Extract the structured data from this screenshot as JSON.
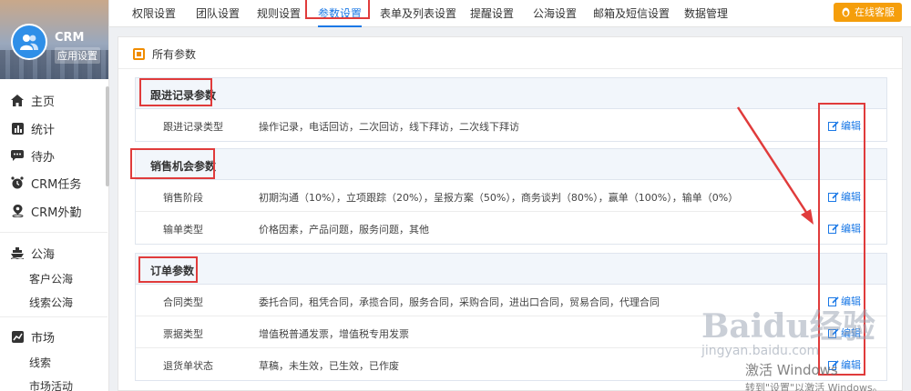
{
  "app": {
    "name": "CRM",
    "subtitle": "应用设置"
  },
  "sidebar": {
    "items": [
      {
        "label": "主页",
        "icon": "home-icon"
      },
      {
        "label": "统计",
        "icon": "bar-chart-icon"
      },
      {
        "label": "待办",
        "icon": "chat-icon"
      },
      {
        "label": "CRM任务",
        "icon": "alarm-clock-icon"
      },
      {
        "label": "CRM外勤",
        "icon": "location-pin-icon"
      }
    ],
    "groups": [
      {
        "label": "公海",
        "icon": "ship-icon",
        "subitems": [
          "客户公海",
          "线索公海"
        ]
      },
      {
        "label": "市场",
        "icon": "trend-chart-icon",
        "subitems": [
          "线索",
          "市场活动"
        ]
      }
    ]
  },
  "tabs": [
    "权限设置",
    "团队设置",
    "规则设置",
    "参数设置",
    "表单及列表设置",
    "提醒设置",
    "公海设置",
    "邮箱及短信设置",
    "数据管理"
  ],
  "active_tab": "参数设置",
  "service_button": "在线客服",
  "main": {
    "title": "所有参数",
    "edit_label": "编辑",
    "sections": [
      {
        "title": "跟进记录参数",
        "rows": [
          {
            "label": "跟进记录类型",
            "value": "操作记录，电话回访，二次回访，线下拜访，二次线下拜访"
          }
        ]
      },
      {
        "title": "销售机会参数",
        "rows": [
          {
            "label": "销售阶段",
            "value": "初期沟通（10%），立项跟踪（20%），呈报方案（50%），商务谈判（80%），赢单（100%），输单（0%）"
          },
          {
            "label": "输单类型",
            "value": "价格因素，产品问题，服务问题，其他"
          }
        ]
      },
      {
        "title": "订单参数",
        "rows": [
          {
            "label": "合同类型",
            "value": "委托合同，租凭合同，承揽合同，服务合同，采购合同，进出口合同，贸易合同，代理合同"
          },
          {
            "label": "票据类型",
            "value": "增值税普通发票，增值税专用发票"
          },
          {
            "label": "退货单状态",
            "value": "草稿，未生效，已生效，已作废"
          }
        ]
      }
    ]
  },
  "watermark": {
    "brand": "Baidu经验",
    "url": "jingyan.baidu.com"
  },
  "activation": {
    "line1": "激活 Windows",
    "line2": "转到\"设置\"以激活 Windows。"
  },
  "colors": {
    "accent": "#1a78e6",
    "annotation": "#e03b3b",
    "service": "#f59e0b"
  }
}
